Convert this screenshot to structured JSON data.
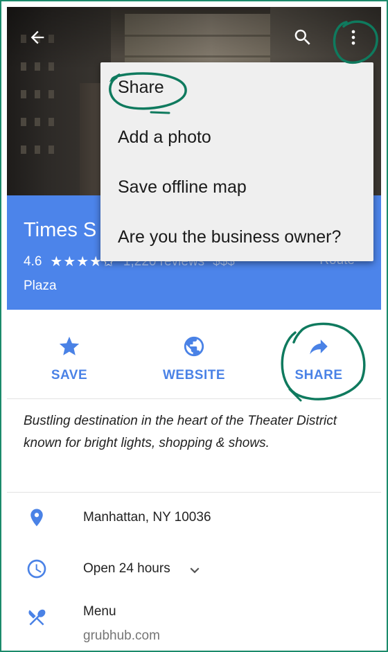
{
  "topbar": {
    "back_icon": "arrow-back-icon",
    "search_icon": "search-icon",
    "more_icon": "more-vert-icon"
  },
  "header": {
    "title": "Times S",
    "rating": "4.6",
    "stars": "★★★★✩",
    "reviews": "1,220 reviews",
    "price": "$$$",
    "route_label": "Route",
    "subtitle": "Plaza"
  },
  "actions": [
    {
      "label": "SAVE",
      "icon": "star-icon"
    },
    {
      "label": "WEBSITE",
      "icon": "globe-icon"
    },
    {
      "label": "SHARE",
      "icon": "share-arrow-icon"
    }
  ],
  "description": "Bustling destination in the heart of the Theater District known for bright lights, shopping & shows.",
  "info": {
    "address": "Manhattan, NY 10036",
    "hours": "Open 24 hours",
    "menu_label": "Menu",
    "menu_source": "grubhub.com"
  },
  "menu": {
    "items": [
      "Share",
      "Add a photo",
      "Save offline map",
      "Are you the business owner?"
    ]
  },
  "colors": {
    "accent": "#4a82e6",
    "header_bg": "#4c84ea",
    "annotation": "#0f7a5e",
    "frame": "#1b8a6b"
  }
}
